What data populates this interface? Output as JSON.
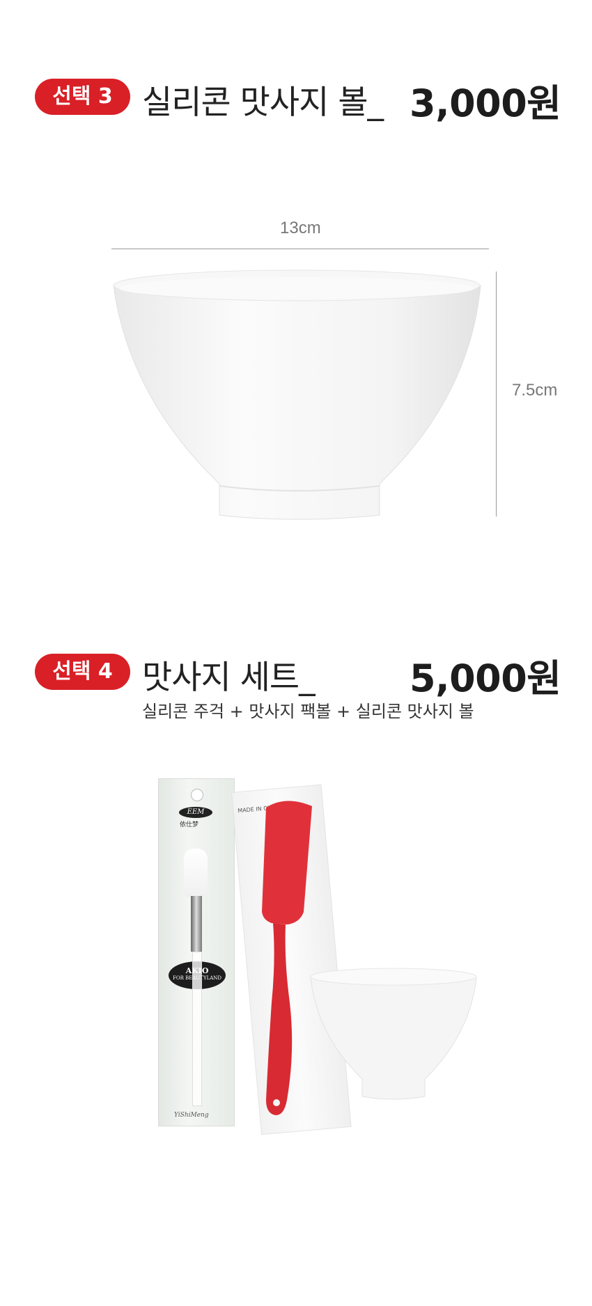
{
  "option3": {
    "badge": "선택 3",
    "title": "실리콘 맛사지 볼_",
    "price": "3,000원",
    "width_label": "13cm",
    "height_label": "7.5cm"
  },
  "option4": {
    "badge": "선택 4",
    "title": "맛사지 세트_",
    "price": "5,000원",
    "subtitle": "실리콘 주걱 + 맛사지 팩볼 + 실리콘 맛사지 볼",
    "brush_pack": {
      "brand": "EEM",
      "brand_cn": "依仕梦",
      "label_line1": "AKIO",
      "label_line2": "FOR BEAUTYLAND",
      "signature": "YiShiMeng"
    },
    "spatula_pack": {
      "print": "MADE IN CH"
    }
  },
  "colors": {
    "badge": "#d92027",
    "spatula": "#e0313a"
  }
}
